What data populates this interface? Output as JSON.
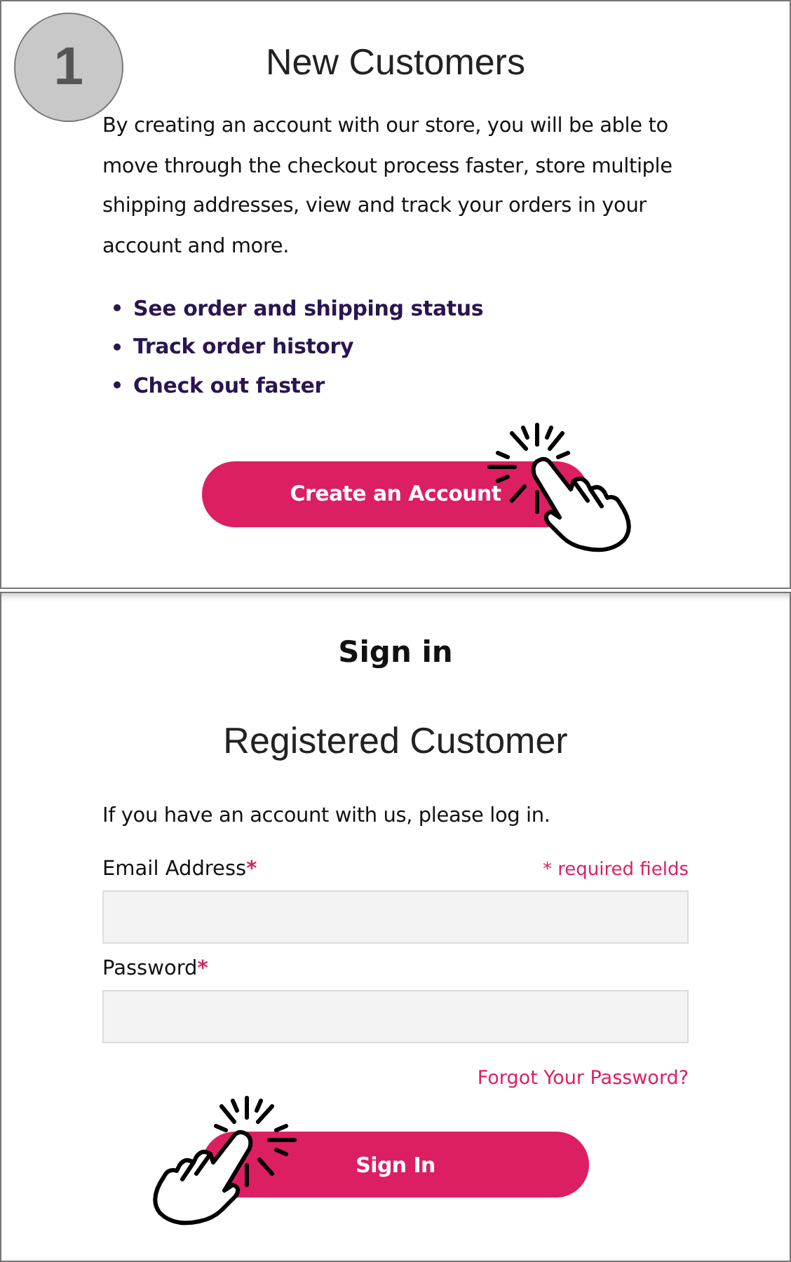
{
  "step_badge": "1",
  "new_customers": {
    "title": "New Customers",
    "description": "By creating an account with our store, you will be able to move through the checkout process faster, store multiple shipping addresses, view and track your orders in your account and more.",
    "benefits": [
      "See order and shipping status",
      "Track order history",
      "Check out faster"
    ],
    "button": "Create an Account"
  },
  "sign_in": {
    "title": "Sign in",
    "subtitle": "Registered Customer",
    "intro": "If you have an account with us, please log in.",
    "required_note": "* required fields",
    "fields": [
      {
        "label": "Email Address",
        "required_mark": "*"
      },
      {
        "label": "Password",
        "required_mark": "*"
      }
    ],
    "forgot_link": "Forgot Your Password?",
    "button": "Sign In"
  }
}
